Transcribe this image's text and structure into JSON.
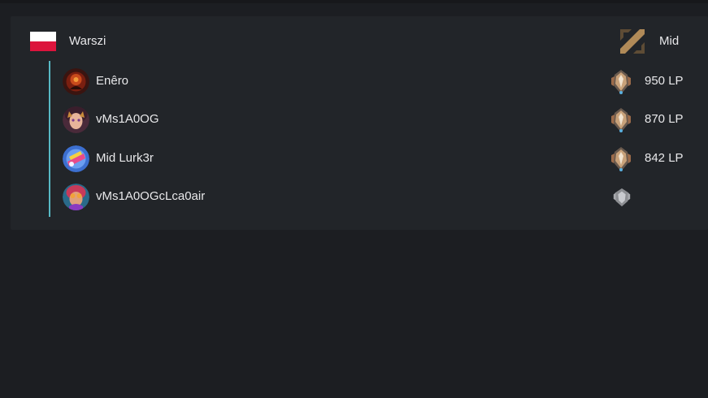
{
  "player": {
    "name": "Warszi",
    "country_flag": "poland-flag",
    "role": "Mid",
    "role_icon": "mid-lane-icon"
  },
  "accounts": [
    {
      "name": "Enêro",
      "lp": "950 LP",
      "rank_icon": "challenger-rank-icon"
    },
    {
      "name": "vMs1A0OG",
      "lp": "870 LP",
      "rank_icon": "challenger-rank-icon"
    },
    {
      "name": "Mid Lurk3r",
      "lp": "842 LP",
      "rank_icon": "challenger-rank-icon"
    },
    {
      "name": "vMs1A0OGcLca0air",
      "lp": "",
      "rank_icon": "unranked-icon"
    }
  ],
  "colors": {
    "background": "#1c1e22",
    "card": "#222529",
    "tree_line": "#58b9c4",
    "flag_white": "#ffffff",
    "flag_red": "#dc143c",
    "role_icon": "#b08a58"
  }
}
